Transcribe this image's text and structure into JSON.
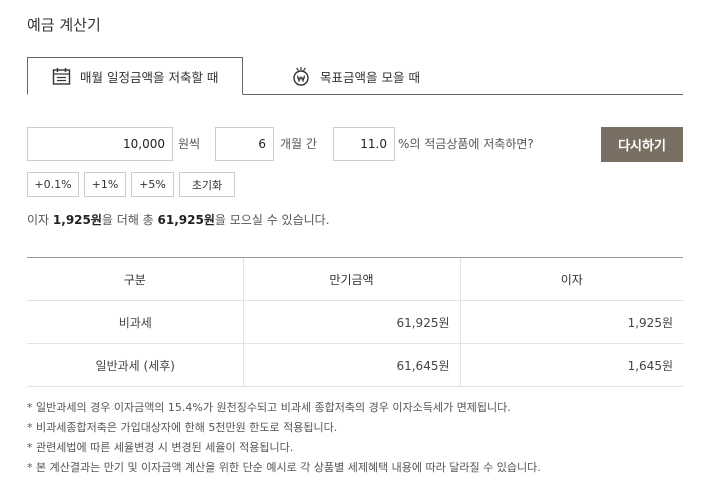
{
  "page": {
    "title": "예금 계산기"
  },
  "tabs": [
    {
      "label": "매월 일정금액을 저축할 때",
      "icon": "calendar-icon",
      "active": true
    },
    {
      "label": "목표금액을 모을 때",
      "icon": "won-coin-icon",
      "active": false
    }
  ],
  "form": {
    "amount": "10,000",
    "amount_unit": "원씩",
    "months": "6",
    "months_unit": "개월 간",
    "rate": "11.0",
    "rate_suffix": "%의 적금상품에 저축하면?",
    "calc_button": "다시하기",
    "adjust_buttons": [
      "+0.1%",
      "+1%",
      "+5%",
      "초기화"
    ]
  },
  "result": {
    "prefix": "이자",
    "interest": "1,925원",
    "middle": "을 더해 총",
    "total": "61,925원",
    "suffix": "을 모으실 수 있습니다."
  },
  "table": {
    "headers": [
      "구분",
      "만기금액",
      "이자"
    ],
    "rows": [
      [
        "비과세",
        "61,925원",
        "1,925원"
      ],
      [
        "일반과세 (세후)",
        "61,645원",
        "1,645원"
      ]
    ]
  },
  "notes": [
    "* 일반과세의 경우 이자금액의 15.4%가 원천징수되고 비과세 종합저축의 경우 이자소득세가 면제됩니다.",
    "* 비과세종합저축은 가입대상자에 한해 5천만원 한도로 적용됩니다.",
    "* 관련세법에 따른 세율변경 시 변경된 세율이 적용됩니다.",
    "* 본 계산결과는 만기 및 이자금액 계산을 위한 단순 예시로 각 상품별 세제혜택 내용에 따라 달라질 수 있습니다."
  ],
  "colors": {
    "button": "#7a6f63",
    "border": "#666666"
  }
}
